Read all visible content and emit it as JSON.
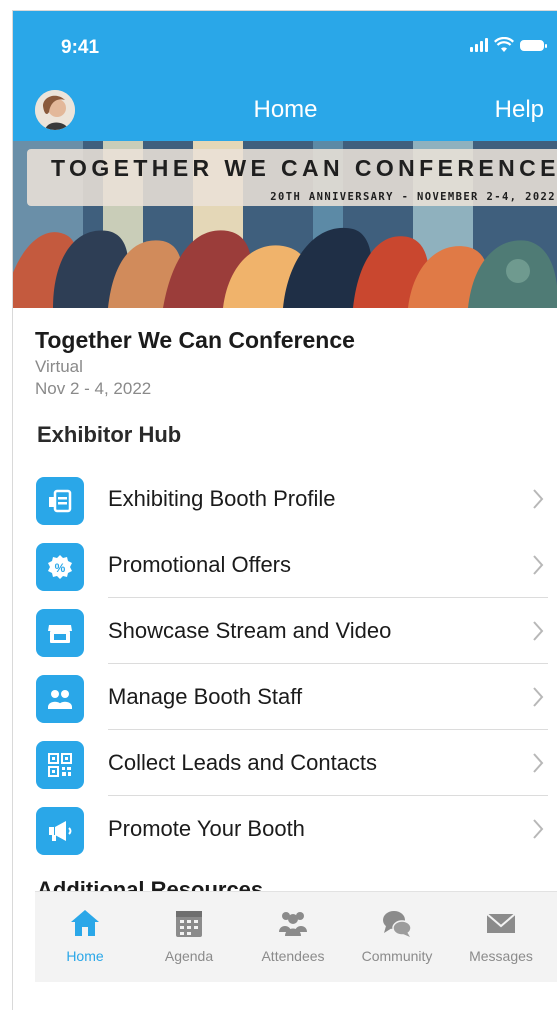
{
  "status_bar": {
    "time": "9:41"
  },
  "nav": {
    "title": "Home",
    "help_label": "Help"
  },
  "banner": {
    "title": "TOGETHER WE CAN CONFERENCE",
    "subtitle": "20TH ANNIVERSARY - NOVEMBER 2-4, 2022"
  },
  "event": {
    "title": "Together We Can Conference",
    "location": "Virtual",
    "dates": "Nov 2 - 4, 2022"
  },
  "section_title": "Exhibitor Hub",
  "menu": {
    "items": [
      {
        "label": "Exhibiting Booth Profile",
        "icon": "booth-profile-icon"
      },
      {
        "label": "Promotional Offers",
        "icon": "percent-badge-icon"
      },
      {
        "label": "Showcase Stream and Video",
        "icon": "storefront-icon"
      },
      {
        "label": "Manage Booth Staff",
        "icon": "staff-group-icon"
      },
      {
        "label": "Collect Leads and Contacts",
        "icon": "qr-code-icon"
      },
      {
        "label": "Promote Your Booth",
        "icon": "megaphone-icon"
      }
    ]
  },
  "additional_resources_title": "Additional Resources",
  "tabbar": {
    "tabs": [
      {
        "label": "Home",
        "icon": "home-icon",
        "active": true
      },
      {
        "label": "Agenda",
        "icon": "calendar-icon",
        "active": false
      },
      {
        "label": "Attendees",
        "icon": "attendees-icon",
        "active": false
      },
      {
        "label": "Community",
        "icon": "community-icon",
        "active": false
      },
      {
        "label": "Messages",
        "icon": "mail-icon",
        "active": false
      }
    ]
  },
  "colors": {
    "accent": "#2aa7e8",
    "text": "#1b1b1b",
    "muted": "#8a8a8a",
    "tab_inactive": "#8b8b8b"
  }
}
